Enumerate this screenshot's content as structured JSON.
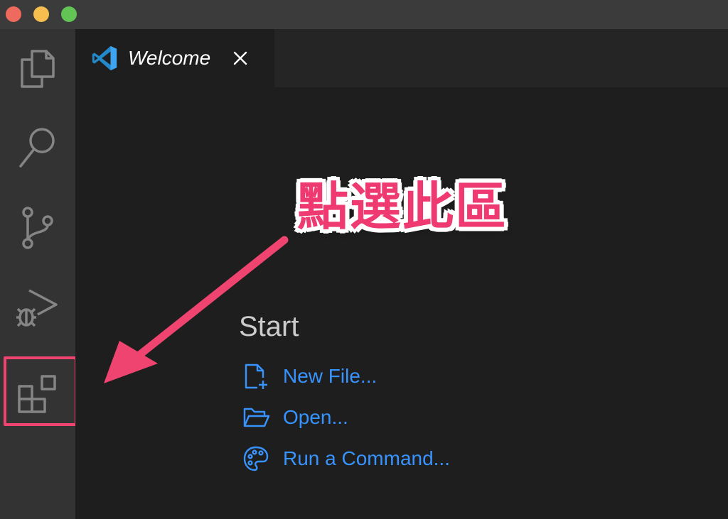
{
  "window": {
    "traffic_lights": [
      "close",
      "minimize",
      "maximize"
    ]
  },
  "activity_bar": {
    "items": [
      "explorer-icon",
      "search-icon",
      "source-control-icon",
      "run-debug-icon",
      "extensions-icon"
    ]
  },
  "tabs": [
    {
      "label": "Welcome",
      "icon": "vscode-logo-icon"
    }
  ],
  "start": {
    "title": "Start",
    "items": [
      {
        "label": "New File...",
        "icon": "new-file-icon"
      },
      {
        "label": "Open...",
        "icon": "open-folder-icon"
      },
      {
        "label": "Run a Command...",
        "icon": "palette-icon"
      }
    ]
  },
  "annotation": {
    "text": "點選此區",
    "color": "#ee3a71"
  },
  "colors": {
    "accent": "#3794ff",
    "annotation": "#ef4470"
  }
}
